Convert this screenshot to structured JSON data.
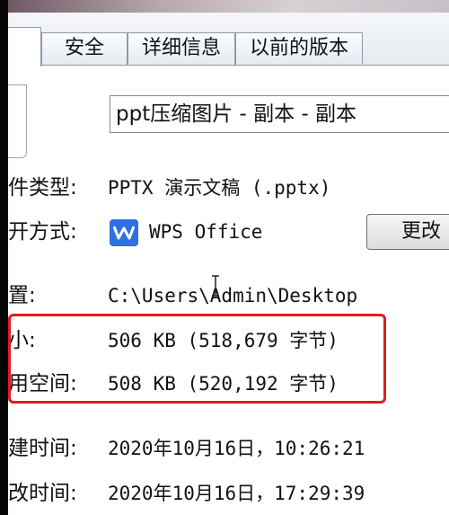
{
  "tabs": [
    {
      "label": "安全"
    },
    {
      "label": "详细信息"
    },
    {
      "label": "以前的版本"
    }
  ],
  "file_name": "ppt压缩图片 - 副本 - 副本",
  "properties": {
    "file_type": {
      "label": "件类型:",
      "value": "PPTX 演示文稿 (.pptx)"
    },
    "opens_with": {
      "label": "开方式:",
      "value": "WPS Office",
      "button": "更改"
    },
    "location": {
      "label": "置:",
      "value": "C:\\Users\\Admin\\Desktop"
    },
    "size": {
      "label": "小:",
      "value": "506 KB (518,679 字节)"
    },
    "size_on_disk": {
      "label": "用空间:",
      "value": "508 KB (520,192 字节)"
    },
    "created": {
      "label": "建时间:",
      "value": "2020年10月16日，10:26:21"
    },
    "modified": {
      "label": "改时间:",
      "value": "2020年10月16日，17:29:39"
    }
  },
  "colors": {
    "highlight_border": "#e01b24",
    "wps_icon": "#2f6fe0"
  },
  "icons": [
    "file-icon",
    "wps-office-icon",
    "text-cursor-icon"
  ]
}
